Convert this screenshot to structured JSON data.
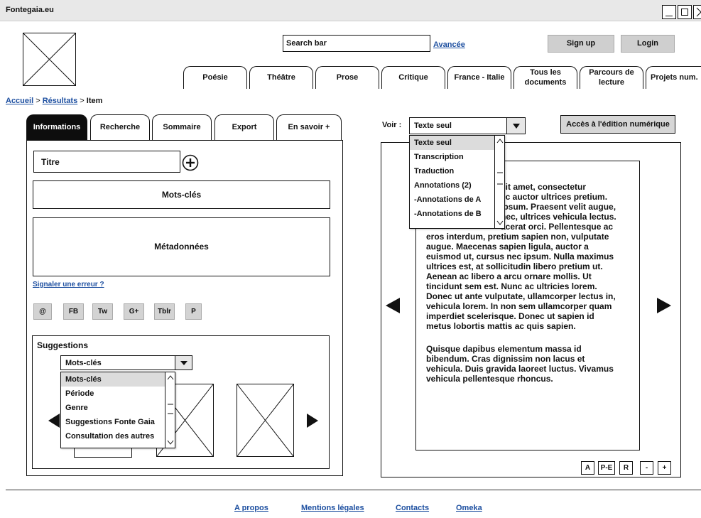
{
  "window": {
    "title": "Fontegaia.eu"
  },
  "header": {
    "search_placeholder": "Search bar",
    "advanced_label": "Avancée",
    "signup_label": "Sign up",
    "login_label": "Login"
  },
  "nav": {
    "tabs": [
      {
        "label": "Poésie"
      },
      {
        "label": "Théâtre"
      },
      {
        "label": "Prose"
      },
      {
        "label": "Critique"
      },
      {
        "label": "France - Italie"
      },
      {
        "label": "Tous les documents"
      },
      {
        "label": "Parcours de lecture"
      },
      {
        "label": "Projets num."
      }
    ]
  },
  "breadcrumb": {
    "home": "Accueil",
    "sep1": " > ",
    "results": "Résultats",
    "sep2": " > ",
    "current": "Item"
  },
  "left": {
    "tabs": [
      "Informations",
      "Recherche",
      "Sommaire",
      "Export",
      "En savoir +"
    ],
    "title_field": "Titre",
    "keywords_box": "Mots-clés",
    "metadata_box": "Métadonnées",
    "report_link": "Signaler une erreur ?",
    "share_buttons": [
      "@",
      "FB",
      "Tw",
      "G+",
      "Tblr",
      "P"
    ],
    "suggestions": {
      "heading": "Suggestions",
      "selected": "Mots-clés",
      "options": [
        "Mots-clés",
        "Période",
        "Genre",
        "Suggestions Fonte Gaia",
        "Consultation des autres"
      ]
    }
  },
  "right": {
    "voir_label": "Voir :",
    "selected": "Texte seul",
    "options": [
      "Texte seul",
      "Transcription",
      "Traduction",
      "Annotations (2)",
      "-Annotations de A",
      "-Annotations de B"
    ],
    "edition_button": "Accès à l'édition numérique",
    "text_lines": [
      "sit amet, consectetur",
      "ec auctor ultrices pretium.",
      "ipsum. Praesent velit augue,",
      "nec, ultrices vehicula lectus.",
      "acerat orci. Pellentesque ac",
      "eros interdum, pretium sapien non, vulputate",
      "augue. Maecenas sapien ligula, auctor a",
      "euismod ut, cursus nec ipsum. Nulla maximus",
      "ultrices est, at sollicitudin libero pretium ut.",
      "Aenean ac libero a arcu ornare mollis. Ut",
      "tincidunt sem est. Nunc ac ultricies lorem.",
      "Donec ut ante vulputate, ullamcorper lectus in,",
      "vehicula lorem. In non sem ullamcorper quam",
      "imperdiet scelerisque. Donec ut sapien id",
      "metus lobortis mattis ac quis sapien."
    ],
    "text_para2": [
      "Quisque dapibus elementum massa id",
      "bibendum. Cras dignissim non lacus et",
      "vehicula. Duis gravida laoreet luctus. Vivamus",
      "vehicula pellentesque rhoncus."
    ],
    "tools": [
      "A",
      "P-E",
      "R",
      "-",
      "+"
    ]
  },
  "footer": {
    "links": [
      "A propos",
      "Mentions légales",
      "Contacts",
      "Omeka"
    ]
  }
}
